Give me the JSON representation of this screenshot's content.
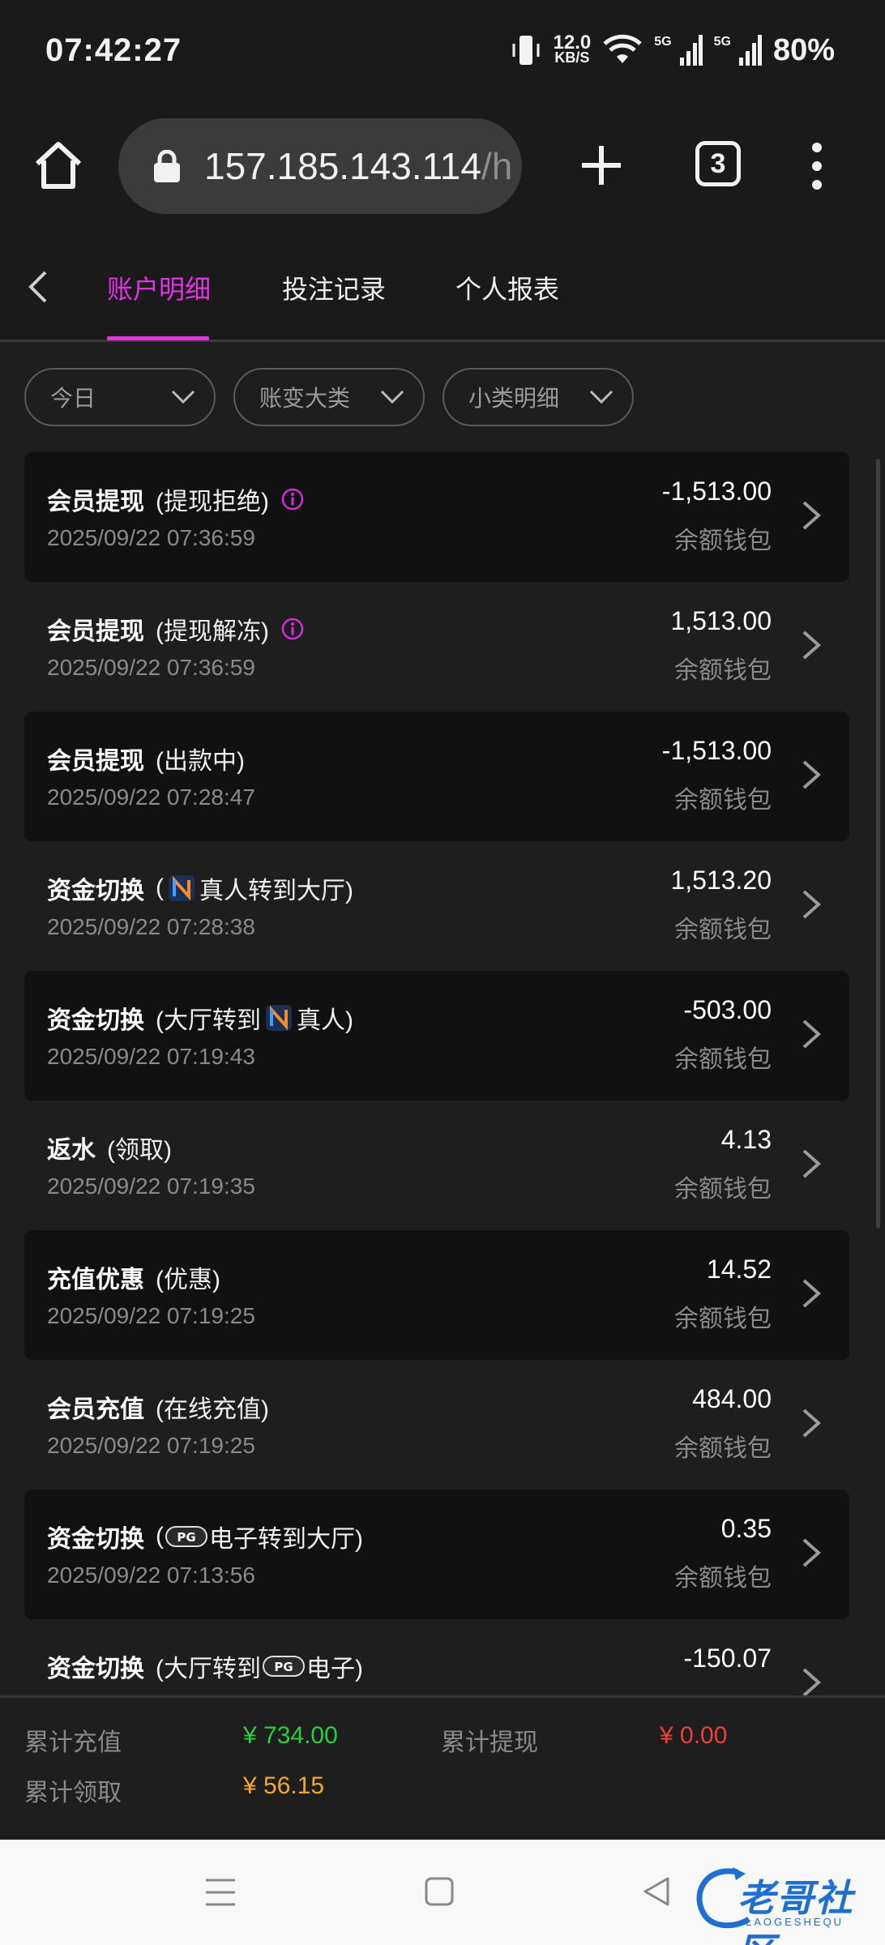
{
  "status_bar": {
    "time": "07:42:27",
    "net_speed": "12.0",
    "net_unit": "KB/S",
    "net_type_1": "5G",
    "net_type_2": "5G",
    "battery": "80%"
  },
  "browser": {
    "url": "157.185.143.114",
    "url_suffix": "/h",
    "tab_count": "3"
  },
  "nav": {
    "tabs": [
      {
        "label": "账户明细",
        "active": true
      },
      {
        "label": "投注记录",
        "active": false
      },
      {
        "label": "个人报表",
        "active": false
      }
    ]
  },
  "filters": [
    {
      "label": "今日"
    },
    {
      "label": "账变大类"
    },
    {
      "label": "小类明细"
    }
  ],
  "transactions": [
    {
      "type": "会员提现",
      "sub_pre": "(提现拒绝)",
      "sub_post": "",
      "logo": "",
      "info": true,
      "date": "2025/09/22 07:36:59",
      "amount": "-1,513.00",
      "wallet": "余额钱包"
    },
    {
      "type": "会员提现",
      "sub_pre": "(提现解冻)",
      "sub_post": "",
      "logo": "",
      "info": true,
      "date": "2025/09/22 07:36:59",
      "amount": "1,513.00",
      "wallet": "余额钱包"
    },
    {
      "type": "会员提现",
      "sub_pre": "(出款中)",
      "sub_post": "",
      "logo": "",
      "info": false,
      "date": "2025/09/22 07:28:47",
      "amount": "-1,513.00",
      "wallet": "余额钱包"
    },
    {
      "type": "资金切换",
      "sub_pre": "(",
      "sub_post": "真人转到大厅)",
      "logo": "n",
      "info": false,
      "date": "2025/09/22 07:28:38",
      "amount": "1,513.20",
      "wallet": "余额钱包"
    },
    {
      "type": "资金切换",
      "sub_pre": "(大厅转到",
      "sub_post": "真人)",
      "logo": "n",
      "info": false,
      "date": "2025/09/22 07:19:43",
      "amount": "-503.00",
      "wallet": "余额钱包"
    },
    {
      "type": "返水",
      "sub_pre": "(领取)",
      "sub_post": "",
      "logo": "",
      "info": false,
      "date": "2025/09/22 07:19:35",
      "amount": "4.13",
      "wallet": "余额钱包"
    },
    {
      "type": "充值优惠",
      "sub_pre": "(优惠)",
      "sub_post": "",
      "logo": "",
      "info": false,
      "date": "2025/09/22 07:19:25",
      "amount": "14.52",
      "wallet": "余额钱包"
    },
    {
      "type": "会员充值",
      "sub_pre": "(在线充值)",
      "sub_post": "",
      "logo": "",
      "info": false,
      "date": "2025/09/22 07:19:25",
      "amount": "484.00",
      "wallet": "余额钱包"
    },
    {
      "type": "资金切换",
      "sub_pre": "(",
      "sub_post": "电子转到大厅)",
      "logo": "pg",
      "info": false,
      "date": "2025/09/22 07:13:56",
      "amount": "0.35",
      "wallet": "余额钱包"
    },
    {
      "type": "资金切换",
      "sub_pre": "(大厅转到",
      "sub_post": "电子)",
      "logo": "pg",
      "info": false,
      "date": "",
      "amount": "-150.07",
      "wallet": ""
    }
  ],
  "summary": {
    "recharge_label": "累计充值",
    "recharge_value": "¥ 734.00",
    "withdraw_label": "累计提现",
    "withdraw_value": "¥ 0.00",
    "claim_label": "累计领取",
    "claim_value": "¥ 56.15",
    "colors": {
      "recharge": "#2ecc40",
      "withdraw": "#e8413c",
      "claim": "#f5a623"
    }
  },
  "watermark": {
    "text": "老哥社区",
    "sub": "LAOGESHEQU"
  },
  "accent_color": "#e234e6"
}
